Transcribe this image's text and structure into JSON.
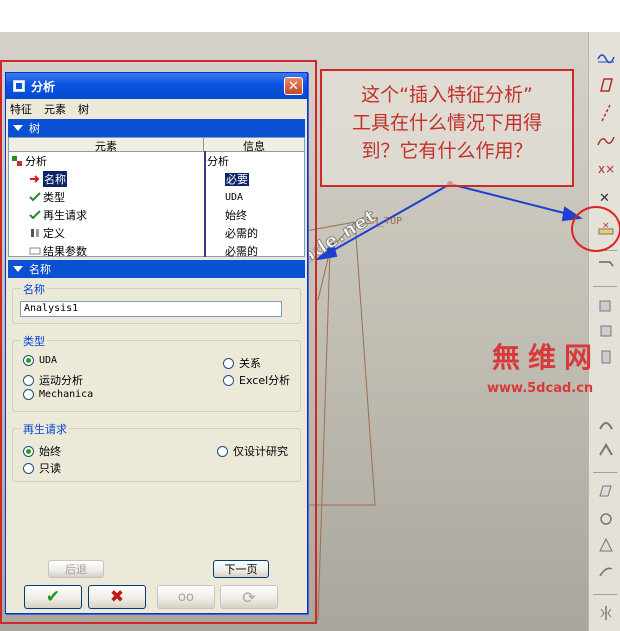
{
  "dialog": {
    "title": "分析",
    "close_glyph": "✕",
    "menu": [
      "特征",
      "元素",
      "树"
    ],
    "tree_section": {
      "label": "树",
      "columns": [
        "元素",
        "信息"
      ],
      "rows": [
        {
          "element": "分析",
          "info": "分析",
          "icon": "feature-icon"
        },
        {
          "element": "名称",
          "info": "必要",
          "icon": "arrow-icon",
          "selected": true
        },
        {
          "element": "类型",
          "info": "UDA",
          "icon": "check-icon"
        },
        {
          "element": "再生请求",
          "info": "始终",
          "icon": "check-icon"
        },
        {
          "element": "定义",
          "info": "必需的",
          "icon": "definition-icon"
        },
        {
          "element": "结果参数",
          "info": "必需的",
          "icon": "params-icon"
        }
      ]
    },
    "name_section": {
      "label": "名称",
      "name_group_label": "名称",
      "name_value": "Analysis1",
      "type_group_label": "类型",
      "type_options": [
        "UDA",
        "运动分析",
        "Mechanica",
        "关系",
        "Excel分析"
      ],
      "type_selected": "UDA",
      "regen_group_label": "再生请求",
      "regen_options": [
        "始终",
        "只读",
        "仅设计研究"
      ],
      "regen_selected": "始终"
    },
    "buttons": {
      "back": "后退",
      "next": "下一页",
      "ok_glyph": "✔",
      "cancel_glyph": "✖",
      "preview_glyph": "oo",
      "regen_glyph": "⟳"
    }
  },
  "annotation": {
    "question": "这个“插入特征分析”\n工具在什么情况下用得\n到？它有什么作用？"
  },
  "scene": {
    "asm_label": "ASM_TOP"
  },
  "watermarks": {
    "forum": "bbs.chinade.net",
    "logo": "無维网",
    "url": "www.5dcad.cn"
  },
  "colors": {
    "annotation_red": "#cc2a2a",
    "arrow_blue": "#1f3fd0",
    "title_blue": "#0a53e0"
  }
}
